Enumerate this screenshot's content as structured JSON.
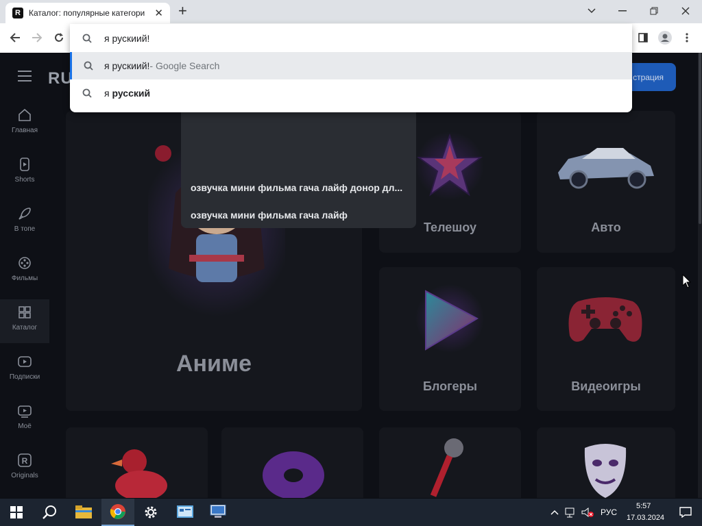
{
  "browser": {
    "tab_title": "Каталог: популярные категории",
    "tab_favicon": "R",
    "omnibox": {
      "query": "я рускиий!",
      "suggestions": [
        {
          "text": "я рускиий!",
          "suffix": " - Google Search",
          "bold": ""
        },
        {
          "text": "я ",
          "suffix": "",
          "bold": "русский"
        }
      ]
    }
  },
  "page": {
    "logo": "RU",
    "register_label": "страция",
    "sidebar": [
      {
        "label": "Главная",
        "icon": "home-icon"
      },
      {
        "label": "Shorts",
        "icon": "shorts-icon"
      },
      {
        "label": "В топе",
        "icon": "rocket-icon"
      },
      {
        "label": "Фильмы",
        "icon": "film-reel-icon"
      },
      {
        "label": "Каталог",
        "icon": "grid-icon"
      },
      {
        "label": "Подписки",
        "icon": "subscriptions-icon"
      },
      {
        "label": "Моё",
        "icon": "my-videos-icon"
      },
      {
        "label": "Originals",
        "icon": "originals-icon"
      }
    ],
    "search_history": [
      "озвучка мини фильма гача лайф донор дл...",
      "озвучка мини фильма гача лайф"
    ],
    "categories": [
      {
        "label": "Аниме"
      },
      {
        "label": "Телешоу"
      },
      {
        "label": "Авто"
      },
      {
        "label": "Блогеры"
      },
      {
        "label": "Видеоигры"
      }
    ]
  },
  "taskbar": {
    "language": "РУС",
    "time": "5:57",
    "date": "17.03.2024"
  }
}
